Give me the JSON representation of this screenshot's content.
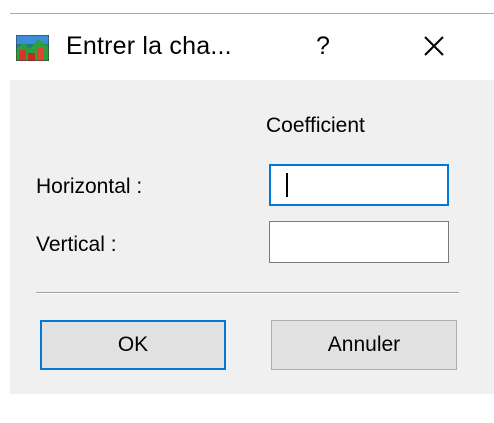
{
  "window": {
    "title": "Entrer la cha...",
    "help_label": "?",
    "app_icon": "colorful-chart-app-icon",
    "close_icon": "close-icon"
  },
  "form": {
    "column_header": "Coefficient",
    "horizontal_label": "Horizontal :",
    "horizontal_value": "",
    "vertical_label": "Vertical :",
    "vertical_value": ""
  },
  "buttons": {
    "ok_label": "OK",
    "cancel_label": "Annuler"
  },
  "colors": {
    "accent": "#0078d7",
    "dialog_bg": "#f0f0f0",
    "button_bg": "#e1e1e1"
  }
}
